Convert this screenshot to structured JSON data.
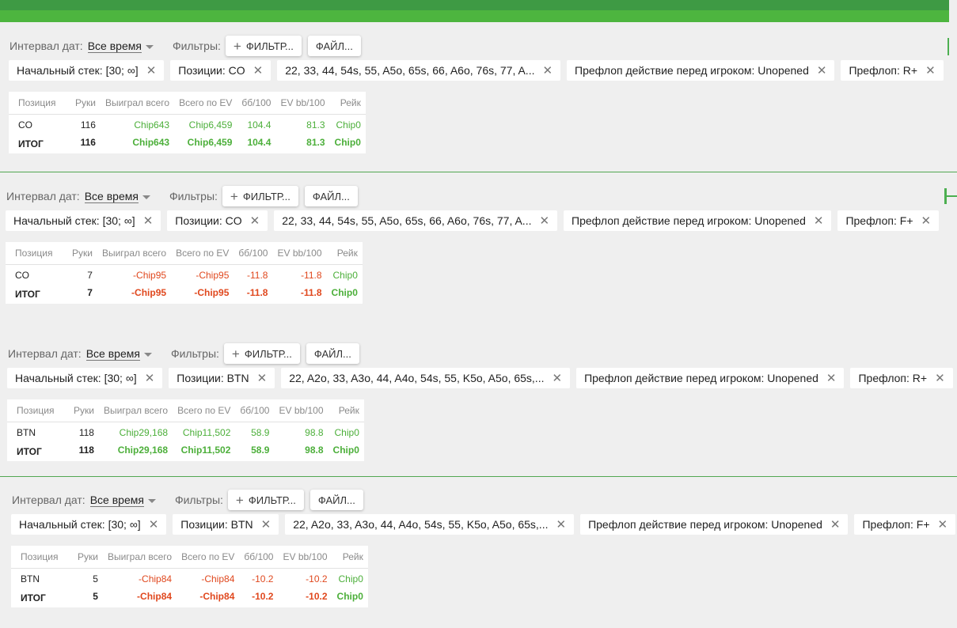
{
  "colors": {
    "accent": "#4db53f",
    "positive": "#4caf3a",
    "negative": "#e0481e"
  },
  "labels": {
    "date_interval": "Интервал дат:",
    "period_value": "Все время",
    "filters": "Фильтры:",
    "filter_button": "ФИЛЬТР...",
    "file_button": "ФАЙЛ..."
  },
  "table_headers": [
    "Позиция",
    "Руки",
    "Выиграл всего",
    "Всего по EV",
    "бб/100",
    "EV bb/100",
    "Рейк"
  ],
  "panels": [
    {
      "chips": [
        "Начальный стек: [30; ∞]",
        "Позиции: CO",
        "22, 33, 44, 54s, 55, A5o, 65s, 66, A6o, 76s, 77, A...",
        "Префлоп действие перед игроком: Unopened",
        "Префлоп: R+"
      ],
      "row": {
        "position": "CO",
        "hands": "116",
        "won": "Chip643",
        "ev": "Chip6,459",
        "bb100": "104.4",
        "evbb100": "81.3",
        "rake": "Chip0"
      },
      "total": {
        "position": "ИТОГ",
        "hands": "116",
        "won": "Chip643",
        "ev": "Chip6,459",
        "bb100": "104.4",
        "evbb100": "81.3",
        "rake": "Chip0"
      }
    },
    {
      "chips": [
        "Начальный стек: [30; ∞]",
        "Позиции: CO",
        "22, 33, 44, 54s, 55, A5o, 65s, 66, A6o, 76s, 77, A...",
        "Префлоп действие перед игроком: Unopened",
        "Префлоп: F+"
      ],
      "row": {
        "position": "CO",
        "hands": "7",
        "won": "-Chip95",
        "ev": "-Chip95",
        "bb100": "-11.8",
        "evbb100": "-11.8",
        "rake": "Chip0"
      },
      "total": {
        "position": "ИТОГ",
        "hands": "7",
        "won": "-Chip95",
        "ev": "-Chip95",
        "bb100": "-11.8",
        "evbb100": "-11.8",
        "rake": "Chip0"
      }
    },
    {
      "chips": [
        "Начальный стек: [30; ∞]",
        "Позиции: BTN",
        "22, A2o, 33, A3o, 44, A4o, 54s, 55, K5o, A5o, 65s,...",
        "Префлоп действие перед игроком: Unopened",
        "Префлоп: R+"
      ],
      "row": {
        "position": "BTN",
        "hands": "118",
        "won": "Chip29,168",
        "ev": "Chip11,502",
        "bb100": "58.9",
        "evbb100": "98.8",
        "rake": "Chip0"
      },
      "total": {
        "position": "ИТОГ",
        "hands": "118",
        "won": "Chip29,168",
        "ev": "Chip11,502",
        "bb100": "58.9",
        "evbb100": "98.8",
        "rake": "Chip0"
      }
    },
    {
      "chips": [
        "Начальный стек: [30; ∞]",
        "Позиции: BTN",
        "22, A2o, 33, A3o, 44, A4o, 54s, 55, K5o, A5o, 65s,...",
        "Префлоп действие перед игроком: Unopened",
        "Префлоп: F+"
      ],
      "row": {
        "position": "BTN",
        "hands": "5",
        "won": "-Chip84",
        "ev": "-Chip84",
        "bb100": "-10.2",
        "evbb100": "-10.2",
        "rake": "Chip0"
      },
      "total": {
        "position": "ИТОГ",
        "hands": "5",
        "won": "-Chip84",
        "ev": "-Chip84",
        "bb100": "-10.2",
        "evbb100": "-10.2",
        "rake": "Chip0"
      }
    }
  ]
}
